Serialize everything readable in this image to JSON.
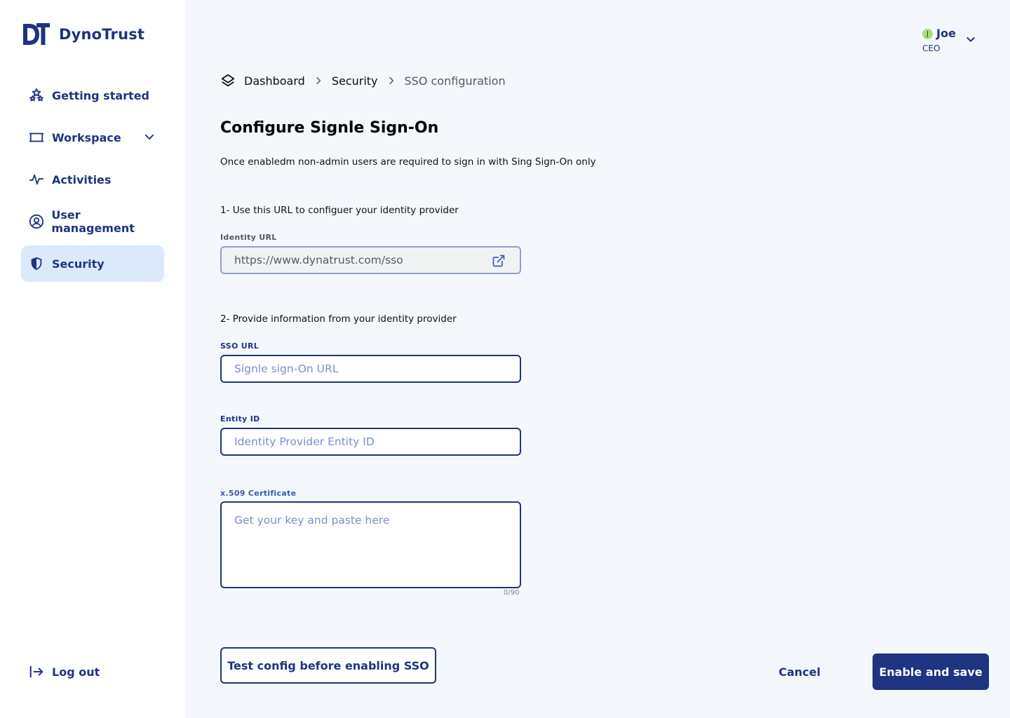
{
  "brand": {
    "name": "DynoTrust",
    "accent": "#1f3480",
    "active_bg": "#dbe9fb"
  },
  "sidebar": {
    "items": [
      {
        "label": "Getting started",
        "icon": "stars-icon"
      },
      {
        "label": "Workspace",
        "icon": "workspace-icon",
        "expandable": true
      },
      {
        "label": "Activities",
        "icon": "activity-icon"
      },
      {
        "label": "User management",
        "icon": "user-circle-icon"
      },
      {
        "label": "Security",
        "icon": "shield-icon",
        "active": true
      }
    ],
    "logout_label": "Log out"
  },
  "user": {
    "initial": "J",
    "name": "Joe",
    "role": "CEO",
    "avatar_color": "#a6df7f"
  },
  "breadcrumb": {
    "items": [
      "Dashboard",
      "Security",
      "SSO configuration"
    ]
  },
  "main": {
    "title": "Configure Signle Sign-On",
    "description": "Once enabledm non-admin users are required to sign in with Sing Sign-On only",
    "step1": "1- Use this URL to configuer your identity provider",
    "identity_url": {
      "label": "Identity URL",
      "value": "https://www.dynatrust.com/sso"
    },
    "step2": "2- Provide information from your identity provider",
    "sso_url": {
      "label": "SSO URL",
      "placeholder": "Signle sign-On URL"
    },
    "entity_id": {
      "label": "Entity ID",
      "placeholder": "Identity Provider Entity ID"
    },
    "certificate": {
      "label": "x.509 Certificate",
      "placeholder": "Get your key and paste here",
      "counter": "0/90"
    }
  },
  "actions": {
    "test_label": "Test config before enabling SSO",
    "cancel_label": "Cancel",
    "save_label": "Enable and save"
  }
}
